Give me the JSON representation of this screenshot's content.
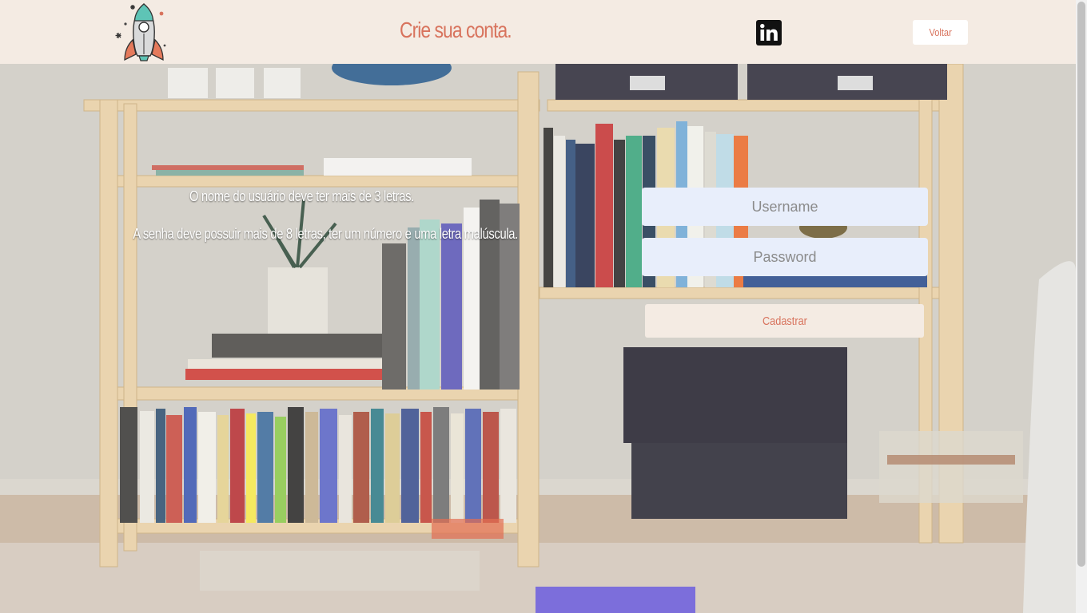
{
  "header": {
    "logo_icon": "rocket-icon",
    "title": "Crie sua conta.",
    "linkedin_icon": "linkedin-icon",
    "back_label": "Voltar"
  },
  "rules": {
    "username_rule": "O nome do usuário deve ter mais de 3 letras.",
    "password_rule": "A senha deve possuir mais de 8 letras, ter um número e uma letra malúscula."
  },
  "form": {
    "username_placeholder": "Username",
    "password_placeholder": "Password",
    "submit_label": "Cadastrar"
  },
  "colors": {
    "accent": "#d8735d",
    "header_bg": "#f4ebe3",
    "input_bg": "#e8eefb"
  }
}
